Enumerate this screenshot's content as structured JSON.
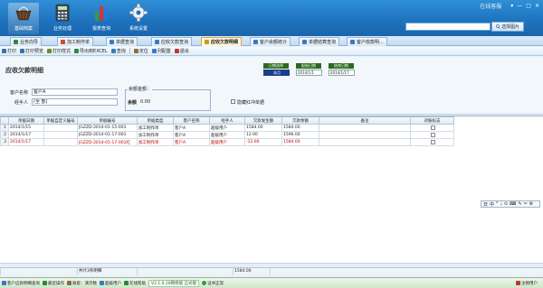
{
  "window": {
    "user_text": "在线客服",
    "controls": [
      "▾",
      "—",
      "□",
      "✕"
    ]
  },
  "ribbon": {
    "buttons": [
      {
        "label": "基础档案",
        "icon": "basket-icon"
      },
      {
        "label": "业务处理",
        "icon": "calculator-icon"
      },
      {
        "label": "报表查询",
        "icon": "bar-chart-icon"
      },
      {
        "label": "系统设置",
        "icon": "gear-icon"
      }
    ],
    "search_placeholder": "",
    "search_button": "选择图片"
  },
  "tabs": [
    {
      "label": "业务向导",
      "color": "#2b8a3e"
    },
    {
      "label": "加工制作单",
      "color": "#d04a2a"
    },
    {
      "label": "单据查询",
      "color": "#3a79c6"
    },
    {
      "label": "应收欠款查询",
      "color": "#3a79c6"
    },
    {
      "label": "应收欠款明细",
      "color": "#c89a28",
      "active": true
    },
    {
      "label": "客户余额统计",
      "color": "#3a79c6"
    },
    {
      "label": "单据结算查询",
      "color": "#3a79c6"
    },
    {
      "label": "客户收款明...",
      "color": "#3a79c6"
    }
  ],
  "toolbar": [
    {
      "label": "打印",
      "color": "#3c6fb0"
    },
    {
      "label": "打印预览",
      "color": "#3c6fb0"
    },
    {
      "label": "打印样式",
      "color": "#6b8e23"
    },
    {
      "label": "导出到EXCEL",
      "color": "#2b8a3e"
    },
    {
      "label": "查询",
      "color": "#3a79c6"
    },
    {
      "label": "定位",
      "color": "#8a6d3b"
    },
    {
      "label": "列配置",
      "color": "#3a79c6"
    },
    {
      "label": "退出",
      "color": "#c0392b"
    }
  ],
  "form": {
    "title": "应收欠款明细",
    "date_heads": [
      "日期选择",
      "起始日期",
      "结束日期"
    ],
    "date_vals": [
      "本月",
      "2014/1/1",
      "2014/1/17"
    ],
    "customer_label": "客户名称",
    "customer_value": "客户A",
    "handler_label": "经手人",
    "handler_value": "(全 部)",
    "balance_group_label": "余额金额：",
    "balance_label": "余额",
    "balance_value": "0.00",
    "hide_label": "隐藏红冲单据"
  },
  "table": {
    "headers": [
      "单据日期",
      "单据自定义编号",
      "单据编号",
      "单据类型",
      "客户名称",
      "经手人",
      "欠款发生额",
      "欠款余额",
      "备注",
      "对账标志"
    ],
    "rows": [
      {
        "n": "1",
        "date": "2014/1/15",
        "custom": "",
        "no": "JGZZD-2014-01-15-001",
        "type": "加工制作单",
        "cust": "客户A",
        "handler": "超级用户",
        "amount": "1584.00",
        "balance": "1584.00",
        "remark": "",
        "red": false
      },
      {
        "n": "2",
        "date": "2014/1/17",
        "custom": "",
        "no": "JGZZD-2014-01-17-001",
        "type": "加工制作单",
        "cust": "客户A",
        "handler": "超级用户",
        "amount": "12.00",
        "balance": "1596.00",
        "remark": "",
        "red": false
      },
      {
        "n": "3",
        "date": "2014/1/17",
        "custom": "",
        "no": "JGZZD-2014-01-17-001红",
        "type": "加工制作单",
        "cust": "客户A",
        "handler": "超级用户",
        "amount": "-12.00",
        "balance": "1584.00",
        "remark": "",
        "red": true
      }
    ],
    "total_label": "共计3条明细",
    "total_value": "1584.00"
  },
  "ime": [
    "日",
    "中",
    "°",
    "♩",
    "⊙",
    "⌨",
    "✎",
    "✂",
    "⚙"
  ],
  "status": {
    "items": [
      {
        "label": "客户应款明细查询",
        "color": "#3a79c6"
      },
      {
        "label": "最近操作",
        "color": "#2b8a3e"
      },
      {
        "label": "账套：演示数",
        "color": "#8a6d3b"
      },
      {
        "label": "超级用户",
        "color": "#3a79c6"
      },
      {
        "label": "在线帮助",
        "color": "#2b8a3e"
      }
    ],
    "version": "V2.1.0.28网络版 正式版",
    "license": "证书正常",
    "logout": "注销用户"
  }
}
